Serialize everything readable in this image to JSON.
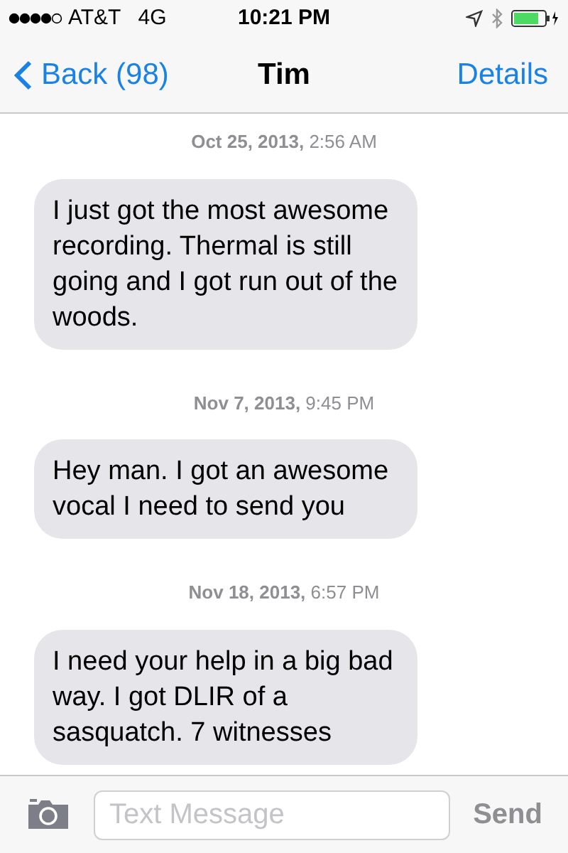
{
  "status_bar": {
    "carrier": "AT&T",
    "network": "4G",
    "time": "10:21 PM"
  },
  "nav": {
    "back": "Back (98)",
    "title": "Tim",
    "action": "Details"
  },
  "messages": [
    {
      "timestamp": "**Oct 25, 2013,** 2:56 AM",
      "text": "I just got the most awesome recording. Thermal is still going and I got run out of the woods."
    },
    {
      "timestamp": "**Nov 7, 2013,** 9:45 PM",
      "text": "Hey man. I got an awesome vocal I need to send you"
    },
    {
      "timestamp": "**Nov 18, 2013,** 6:57 PM",
      "text": "I need your help in a big bad way.  I got DLIR of a sasquatch.  7 witnesses"
    }
  ],
  "composer": {
    "placeholder": "Text Message",
    "send": "Send"
  }
}
